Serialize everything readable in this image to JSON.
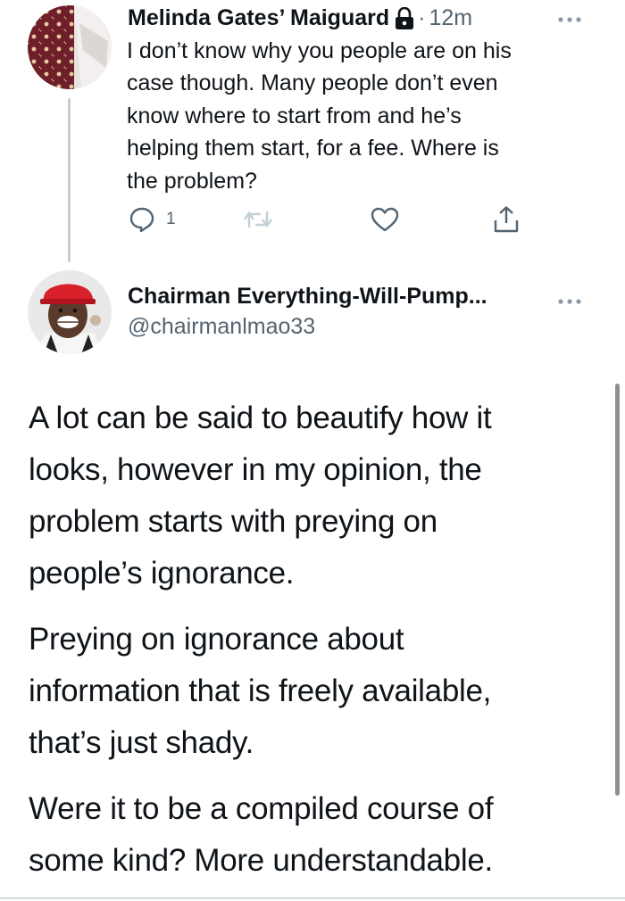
{
  "reply_tweet": {
    "display_name": "Melinda Gates’ Maiguard",
    "separator": "·",
    "time": "12m",
    "protected_icon": "lock-icon",
    "lines": [
      "I don’t know why you people are on his",
      "case though. Many people don’t even",
      "know where to start from and he’s",
      "helping them start, for a fee. Where is",
      "the problem?"
    ],
    "actions": {
      "reply_icon": "comment-icon",
      "reply_count": "1",
      "retweet_icon": "retweet-icon",
      "like_icon": "heart-icon",
      "share_icon": "share-icon"
    },
    "more_icon": "more-options-icon"
  },
  "main_tweet": {
    "display_name": "Chairman Everything-Will-Pump...",
    "handle": "@chairmanlmao33",
    "more_icon": "more-options-icon",
    "paragraphs": [
      {
        "lines": [
          "A lot can be said to beautify how it",
          "looks, however in my opinion, the",
          "problem starts with preying on",
          "people’s ignorance."
        ]
      },
      {
        "lines": [
          "Preying on ignorance about",
          "information that is freely available,",
          "that’s just shady."
        ]
      },
      {
        "lines": [
          "Were it to be a compiled course of",
          "some kind? More understandable."
        ]
      }
    ]
  },
  "colors": {
    "text": "#0f1419",
    "secondary": "#536471",
    "thread_line": "#c4cfd6",
    "background": "#ffffff"
  }
}
